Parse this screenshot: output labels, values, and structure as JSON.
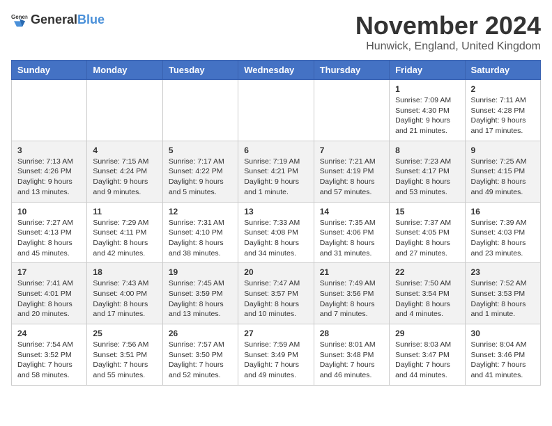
{
  "header": {
    "logo_general": "General",
    "logo_blue": "Blue",
    "month_title": "November 2024",
    "location": "Hunwick, England, United Kingdom"
  },
  "weekdays": [
    "Sunday",
    "Monday",
    "Tuesday",
    "Wednesday",
    "Thursday",
    "Friday",
    "Saturday"
  ],
  "weeks": [
    [
      {
        "day": "",
        "info": ""
      },
      {
        "day": "",
        "info": ""
      },
      {
        "day": "",
        "info": ""
      },
      {
        "day": "",
        "info": ""
      },
      {
        "day": "",
        "info": ""
      },
      {
        "day": "1",
        "info": "Sunrise: 7:09 AM\nSunset: 4:30 PM\nDaylight: 9 hours\nand 21 minutes."
      },
      {
        "day": "2",
        "info": "Sunrise: 7:11 AM\nSunset: 4:28 PM\nDaylight: 9 hours\nand 17 minutes."
      }
    ],
    [
      {
        "day": "3",
        "info": "Sunrise: 7:13 AM\nSunset: 4:26 PM\nDaylight: 9 hours\nand 13 minutes."
      },
      {
        "day": "4",
        "info": "Sunrise: 7:15 AM\nSunset: 4:24 PM\nDaylight: 9 hours\nand 9 minutes."
      },
      {
        "day": "5",
        "info": "Sunrise: 7:17 AM\nSunset: 4:22 PM\nDaylight: 9 hours\nand 5 minutes."
      },
      {
        "day": "6",
        "info": "Sunrise: 7:19 AM\nSunset: 4:21 PM\nDaylight: 9 hours\nand 1 minute."
      },
      {
        "day": "7",
        "info": "Sunrise: 7:21 AM\nSunset: 4:19 PM\nDaylight: 8 hours\nand 57 minutes."
      },
      {
        "day": "8",
        "info": "Sunrise: 7:23 AM\nSunset: 4:17 PM\nDaylight: 8 hours\nand 53 minutes."
      },
      {
        "day": "9",
        "info": "Sunrise: 7:25 AM\nSunset: 4:15 PM\nDaylight: 8 hours\nand 49 minutes."
      }
    ],
    [
      {
        "day": "10",
        "info": "Sunrise: 7:27 AM\nSunset: 4:13 PM\nDaylight: 8 hours\nand 45 minutes."
      },
      {
        "day": "11",
        "info": "Sunrise: 7:29 AM\nSunset: 4:11 PM\nDaylight: 8 hours\nand 42 minutes."
      },
      {
        "day": "12",
        "info": "Sunrise: 7:31 AM\nSunset: 4:10 PM\nDaylight: 8 hours\nand 38 minutes."
      },
      {
        "day": "13",
        "info": "Sunrise: 7:33 AM\nSunset: 4:08 PM\nDaylight: 8 hours\nand 34 minutes."
      },
      {
        "day": "14",
        "info": "Sunrise: 7:35 AM\nSunset: 4:06 PM\nDaylight: 8 hours\nand 31 minutes."
      },
      {
        "day": "15",
        "info": "Sunrise: 7:37 AM\nSunset: 4:05 PM\nDaylight: 8 hours\nand 27 minutes."
      },
      {
        "day": "16",
        "info": "Sunrise: 7:39 AM\nSunset: 4:03 PM\nDaylight: 8 hours\nand 23 minutes."
      }
    ],
    [
      {
        "day": "17",
        "info": "Sunrise: 7:41 AM\nSunset: 4:01 PM\nDaylight: 8 hours\nand 20 minutes."
      },
      {
        "day": "18",
        "info": "Sunrise: 7:43 AM\nSunset: 4:00 PM\nDaylight: 8 hours\nand 17 minutes."
      },
      {
        "day": "19",
        "info": "Sunrise: 7:45 AM\nSunset: 3:59 PM\nDaylight: 8 hours\nand 13 minutes."
      },
      {
        "day": "20",
        "info": "Sunrise: 7:47 AM\nSunset: 3:57 PM\nDaylight: 8 hours\nand 10 minutes."
      },
      {
        "day": "21",
        "info": "Sunrise: 7:49 AM\nSunset: 3:56 PM\nDaylight: 8 hours\nand 7 minutes."
      },
      {
        "day": "22",
        "info": "Sunrise: 7:50 AM\nSunset: 3:54 PM\nDaylight: 8 hours\nand 4 minutes."
      },
      {
        "day": "23",
        "info": "Sunrise: 7:52 AM\nSunset: 3:53 PM\nDaylight: 8 hours\nand 1 minute."
      }
    ],
    [
      {
        "day": "24",
        "info": "Sunrise: 7:54 AM\nSunset: 3:52 PM\nDaylight: 7 hours\nand 58 minutes."
      },
      {
        "day": "25",
        "info": "Sunrise: 7:56 AM\nSunset: 3:51 PM\nDaylight: 7 hours\nand 55 minutes."
      },
      {
        "day": "26",
        "info": "Sunrise: 7:57 AM\nSunset: 3:50 PM\nDaylight: 7 hours\nand 52 minutes."
      },
      {
        "day": "27",
        "info": "Sunrise: 7:59 AM\nSunset: 3:49 PM\nDaylight: 7 hours\nand 49 minutes."
      },
      {
        "day": "28",
        "info": "Sunrise: 8:01 AM\nSunset: 3:48 PM\nDaylight: 7 hours\nand 46 minutes."
      },
      {
        "day": "29",
        "info": "Sunrise: 8:03 AM\nSunset: 3:47 PM\nDaylight: 7 hours\nand 44 minutes."
      },
      {
        "day": "30",
        "info": "Sunrise: 8:04 AM\nSunset: 3:46 PM\nDaylight: 7 hours\nand 41 minutes."
      }
    ]
  ]
}
